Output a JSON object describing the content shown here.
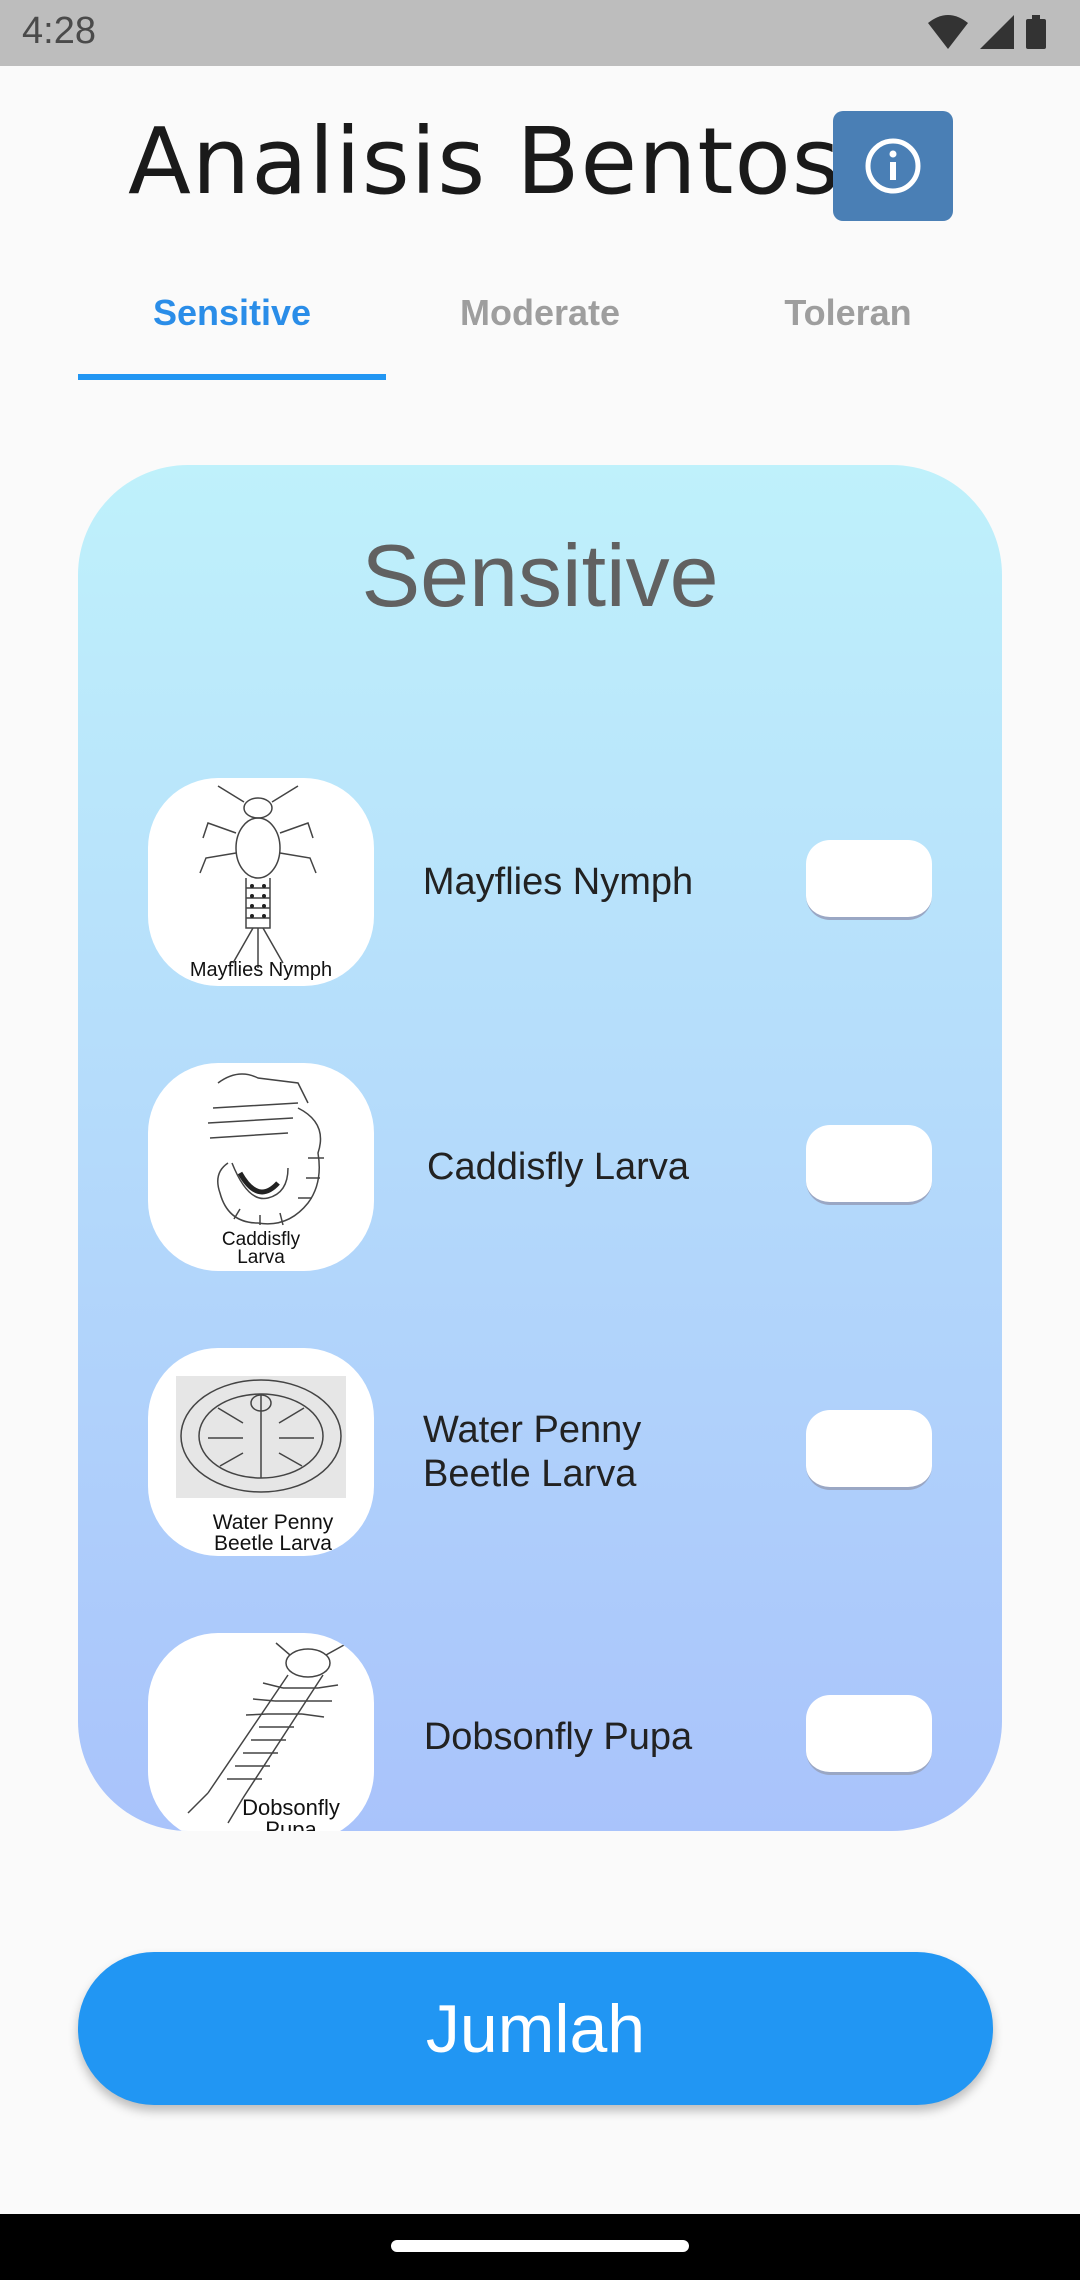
{
  "status_bar": {
    "time": "4:28"
  },
  "header": {
    "title": "Analisis Bentos",
    "info_icon": "info-icon"
  },
  "tabs": [
    {
      "label": "Sensitive",
      "active": true
    },
    {
      "label": "Moderate",
      "active": false
    },
    {
      "label": "Toleran",
      "active": false
    }
  ],
  "card": {
    "title": "Sensitive",
    "items": [
      {
        "name": "Mayflies Nymph",
        "caption_lines": [
          "Mayflies Nymph"
        ],
        "count": ""
      },
      {
        "name": "Caddisfly Larva",
        "caption_lines": [
          "Caddisfly",
          "Larva"
        ],
        "count": ""
      },
      {
        "name": "Water Penny Beetle Larva",
        "caption_lines": [
          "Water Penny",
          "Beetle Larva"
        ],
        "count": ""
      },
      {
        "name": "Dobsonfly Pupa",
        "caption_lines": [
          "Dobsonfly",
          "Pupa"
        ],
        "count": ""
      }
    ]
  },
  "actions": {
    "submit_label": "Jumlah"
  },
  "colors": {
    "accent": "#2196f3",
    "info_button": "#4a7fb5",
    "card_top": "#bff1fb",
    "card_bottom": "#a9c3fb"
  }
}
